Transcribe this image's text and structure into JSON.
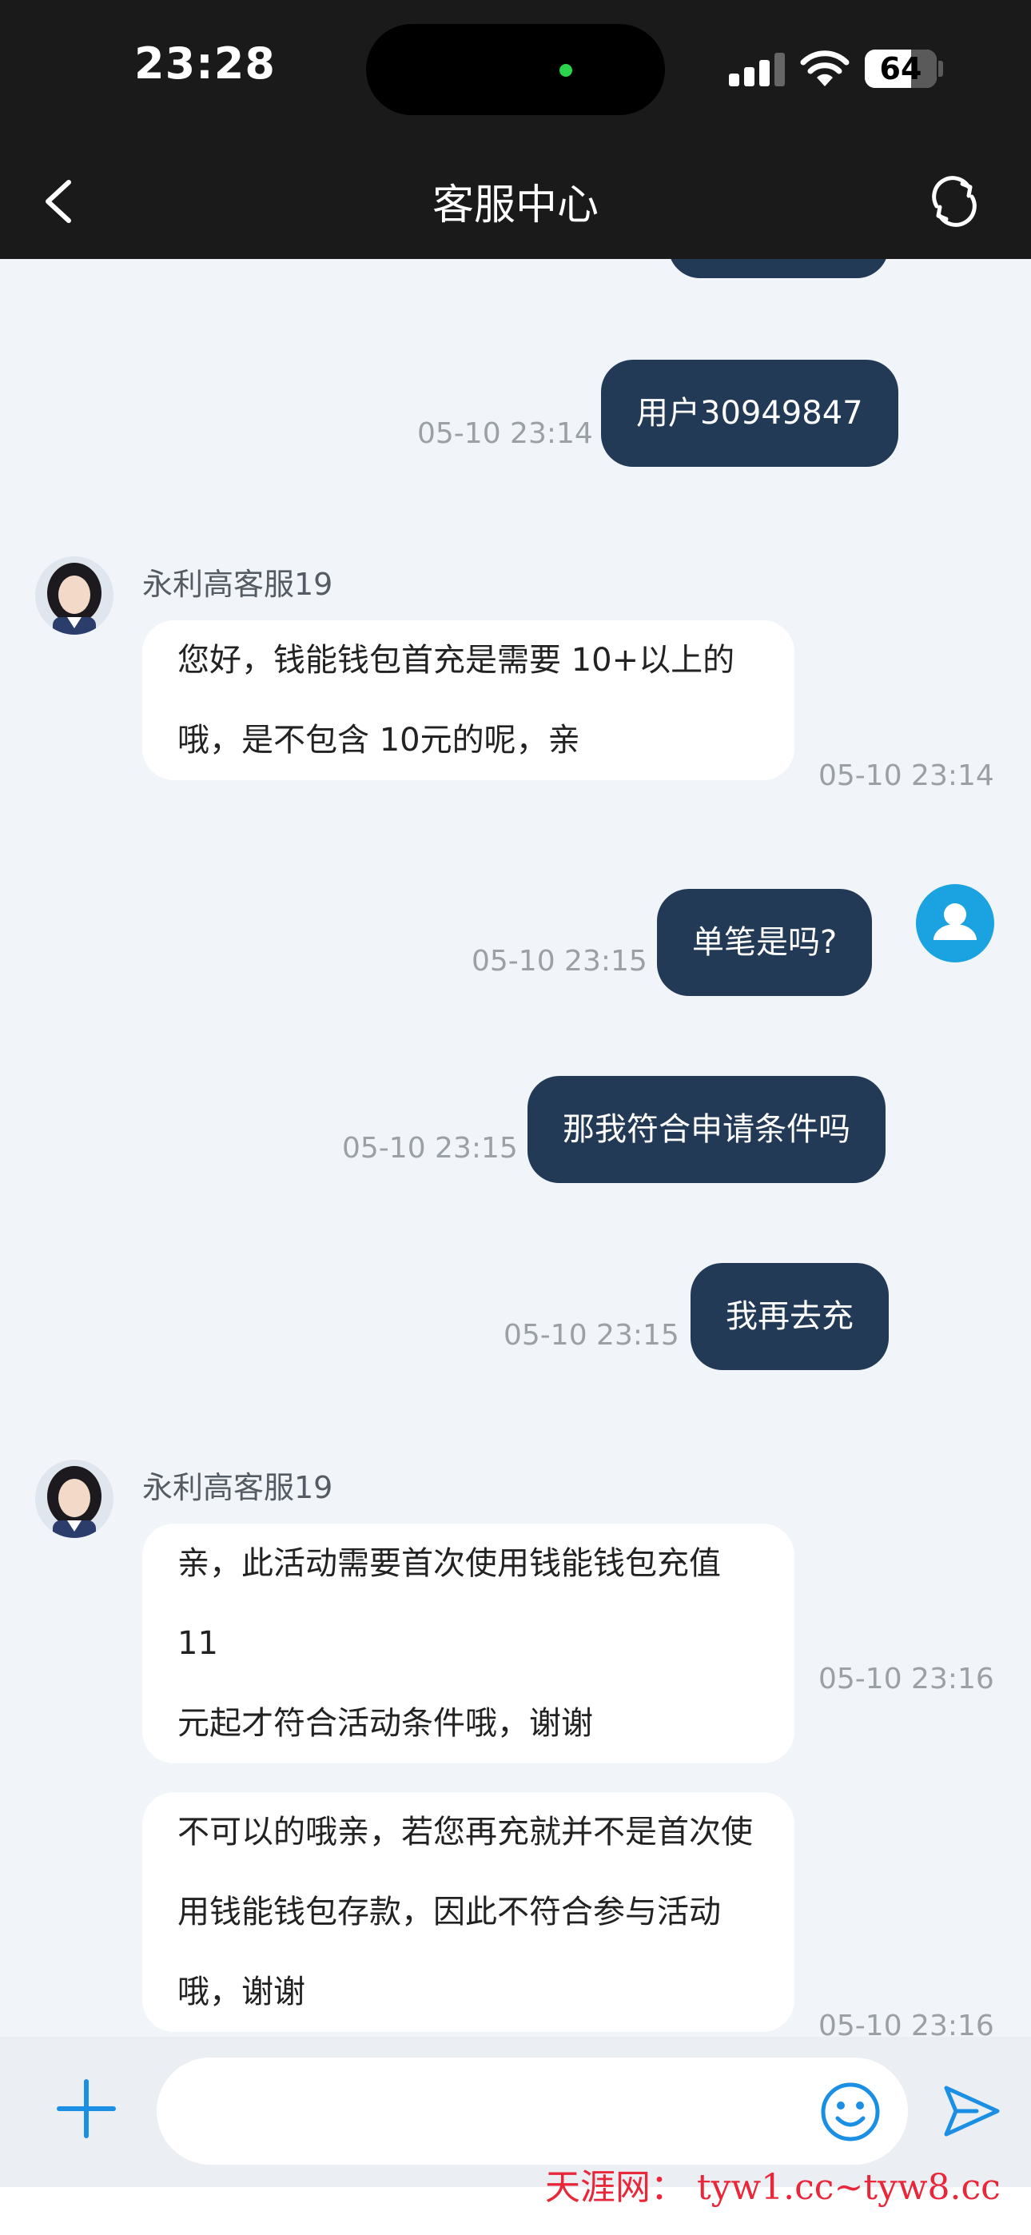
{
  "status_bar": {
    "time": "23:28",
    "battery": "64",
    "battery_level": 0.64,
    "camera_indicator_color": "#2bd44a",
    "icons": [
      "cellular-signal-icon",
      "wifi-icon",
      "battery-icon"
    ]
  },
  "nav": {
    "title": "客服中心",
    "back_icon": "chevron-left-icon",
    "refresh_icon": "refresh-icon"
  },
  "messages": [
    {
      "sender": "me",
      "text": "用户30949847",
      "time": "05-10 23:14"
    },
    {
      "sender": "agent",
      "name": "永利高客服19",
      "lines": [
        "您好，钱能钱包首充是需要 10+以上的",
        "哦，是不包含 10元的呢，亲"
      ],
      "time": "05-10 23:14"
    },
    {
      "sender": "me",
      "text": "单笔是吗?",
      "time": "05-10 23:15"
    },
    {
      "sender": "me",
      "text": "那我符合申请条件吗",
      "time": "05-10 23:15"
    },
    {
      "sender": "me",
      "text": "我再去充",
      "time": "05-10 23:15"
    },
    {
      "sender": "agent",
      "name": "永利高客服19",
      "lines": [
        "亲，此活动需要首次使用钱能钱包充值11",
        "元起才符合活动条件哦，谢谢"
      ],
      "time": "05-10 23:16"
    },
    {
      "sender": "agent",
      "lines": [
        "不可以的哦亲，若您再充就并不是首次使",
        "用钱能钱包存款，因此不符合参与活动",
        "哦，谢谢"
      ],
      "time": "05-10 23:16"
    }
  ],
  "input_bar": {
    "placeholder": "",
    "plus_icon": "plus-icon",
    "emoji_icon": "emoji-icon",
    "send_icon": "send-icon"
  },
  "watermark": "天涯网： tyw1.cc~tyw8.cc",
  "colors": {
    "header_bg": "#1a1a1a",
    "my_bubble": "#233a56",
    "agent_bubble": "#ffffff",
    "chat_bg": "#f1f5f9",
    "accent_blue": "#1a8fe3",
    "user_avatar_bg": "#1aa3e0",
    "watermark_red": "#e8283a"
  }
}
